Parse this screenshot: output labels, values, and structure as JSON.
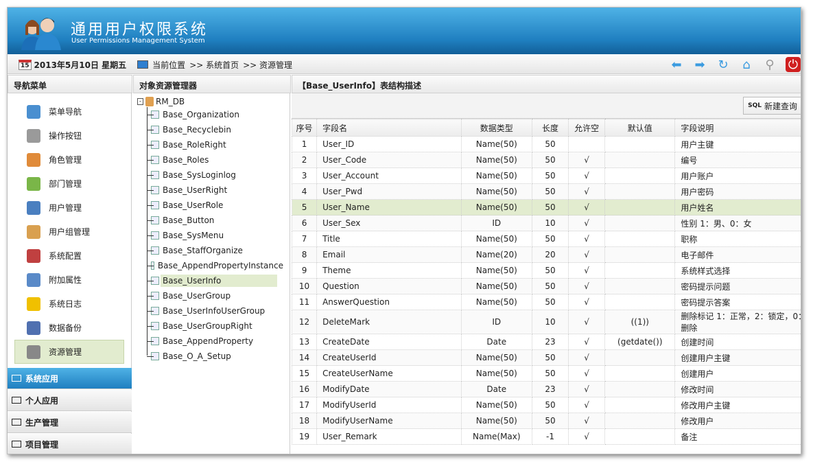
{
  "header": {
    "title": "通用用户权限系统",
    "subtitle": "User Permissions Management System"
  },
  "toolbar": {
    "date": "2013年5月10日 星期五",
    "location_label": "当前位置",
    "breadcrumb": [
      ">> 系统首页",
      ">> 资源管理"
    ],
    "calendar_day": "15",
    "icons": [
      "back-arrow-icon",
      "forward-arrow-icon",
      "refresh-icon",
      "home-icon",
      "search-icon",
      "power-icon"
    ]
  },
  "sidebar": {
    "title": "导航菜单",
    "items": [
      {
        "label": "菜单导航",
        "color": "#4a8fd0"
      },
      {
        "label": "操作按钮",
        "color": "#9a9a9a"
      },
      {
        "label": "角色管理",
        "color": "#e08b3a"
      },
      {
        "label": "部门管理",
        "color": "#7ab648"
      },
      {
        "label": "用户管理",
        "color": "#4a7fc0"
      },
      {
        "label": "用户组管理",
        "color": "#d9a050"
      },
      {
        "label": "系统配置",
        "color": "#c04040"
      },
      {
        "label": "附加属性",
        "color": "#5a8ac8"
      },
      {
        "label": "系统日志",
        "color": "#f0c000"
      },
      {
        "label": "数据备份",
        "color": "#5070b0"
      },
      {
        "label": "资源管理",
        "color": "#888888"
      }
    ],
    "accordion": [
      "系统应用",
      "个人应用",
      "生产管理",
      "项目管理"
    ]
  },
  "tree": {
    "title": "对象资源管理器",
    "root": "RM_DB",
    "nodes": [
      "Base_Organization",
      "Base_Recyclebin",
      "Base_RoleRight",
      "Base_Roles",
      "Base_SysLoginlog",
      "Base_UserRight",
      "Base_UserRole",
      "Base_Button",
      "Base_SysMenu",
      "Base_StaffOrganize",
      "Base_AppendPropertyInstance",
      "Base_UserInfo",
      "Base_UserGroup",
      "Base_UserInfoUserGroup",
      "Base_UserGroupRight",
      "Base_AppendProperty",
      "Base_O_A_Setup"
    ],
    "selected": "Base_UserInfo"
  },
  "main": {
    "title": "【Base_UserInfo】表结构描述",
    "new_query": "新建查询",
    "sql_icon": "SQL",
    "columns": [
      "序号",
      "字段名",
      "数据类型",
      "长度",
      "允许空",
      "默认值",
      "字段说明"
    ],
    "rows": [
      [
        "1",
        "User_ID",
        "Name(50)",
        "50",
        "",
        "",
        "用户主键"
      ],
      [
        "2",
        "User_Code",
        "Name(50)",
        "50",
        "√",
        "",
        "编号"
      ],
      [
        "3",
        "User_Account",
        "Name(50)",
        "50",
        "√",
        "",
        "用户账户"
      ],
      [
        "4",
        "User_Pwd",
        "Name(50)",
        "50",
        "√",
        "",
        "用户密码"
      ],
      [
        "5",
        "User_Name",
        "Name(50)",
        "50",
        "√",
        "",
        "用户姓名"
      ],
      [
        "6",
        "User_Sex",
        "ID",
        "10",
        "√",
        "",
        "性别 1：男、0：女"
      ],
      [
        "7",
        "Title",
        "Name(50)",
        "50",
        "√",
        "",
        "职称"
      ],
      [
        "8",
        "Email",
        "Name(20)",
        "20",
        "√",
        "",
        "电子邮件"
      ],
      [
        "9",
        "Theme",
        "Name(50)",
        "50",
        "√",
        "",
        "系统样式选择"
      ],
      [
        "10",
        "Question",
        "Name(50)",
        "50",
        "√",
        "",
        "密码提示问题"
      ],
      [
        "11",
        "AnswerQuestion",
        "Name(50)",
        "50",
        "√",
        "",
        "密码提示答案"
      ],
      [
        "12",
        "DeleteMark",
        "ID",
        "10",
        "√",
        "((1))",
        "删除标记 1：正常，2：锁定，0：删除"
      ],
      [
        "13",
        "CreateDate",
        "Date",
        "23",
        "√",
        "(getdate())",
        "创建时间"
      ],
      [
        "14",
        "CreateUserId",
        "Name(50)",
        "50",
        "√",
        "",
        "创建用户主键"
      ],
      [
        "15",
        "CreateUserName",
        "Name(50)",
        "50",
        "√",
        "",
        "创建用户"
      ],
      [
        "16",
        "ModifyDate",
        "Date",
        "23",
        "√",
        "",
        "修改时间"
      ],
      [
        "17",
        "ModifyUserId",
        "Name(50)",
        "50",
        "√",
        "",
        "修改用户主键"
      ],
      [
        "18",
        "ModifyUserName",
        "Name(50)",
        "50",
        "√",
        "",
        "修改用户"
      ],
      [
        "19",
        "User_Remark",
        "Name(Max)",
        "-1",
        "√",
        "",
        "备注"
      ]
    ],
    "highlighted_row": "5"
  }
}
